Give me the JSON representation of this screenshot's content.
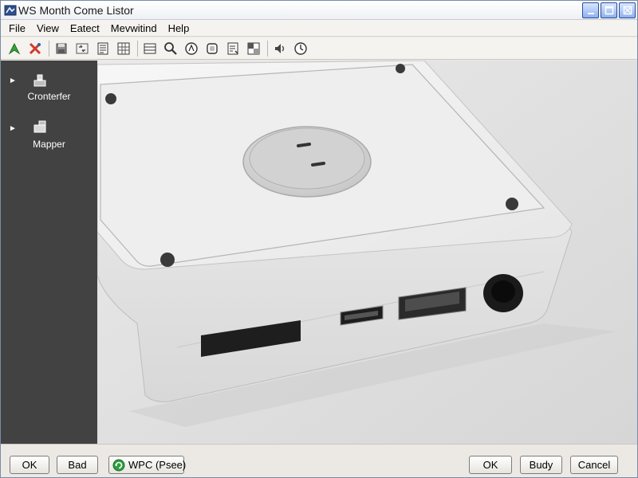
{
  "window": {
    "title": "WS Month Come Listor"
  },
  "menubar": {
    "items": [
      "File",
      "View",
      "Eatect",
      "Mevwitind",
      "Help"
    ]
  },
  "toolbar": {
    "buttons": [
      "forward-icon",
      "tools-icon",
      "disk-icon",
      "swap-icon",
      "document-icon",
      "grid-icon",
      "list-icon",
      "search-icon",
      "compass-icon",
      "layers-icon",
      "notes-icon",
      "window-icon",
      "speaker-icon",
      "clock-icon"
    ]
  },
  "sidebar": {
    "items": [
      {
        "label": "Cronterfer",
        "icon": "device-icon"
      },
      {
        "label": "Mapper",
        "icon": "folder-icon"
      }
    ]
  },
  "viewport": {
    "content": "rendered image of a white rectangular device with ports"
  },
  "bottombar": {
    "left_buttons": [
      "OK",
      "Bad",
      "WPC (Psee)"
    ],
    "right_buttons": [
      "OK",
      "Budy",
      "Cancel"
    ]
  },
  "colors": {
    "sidebar_bg": "#424242",
    "viewport_bg": "#e2e2e2",
    "window_bg": "#ece9e4",
    "device_body": "#f2f2f2"
  }
}
